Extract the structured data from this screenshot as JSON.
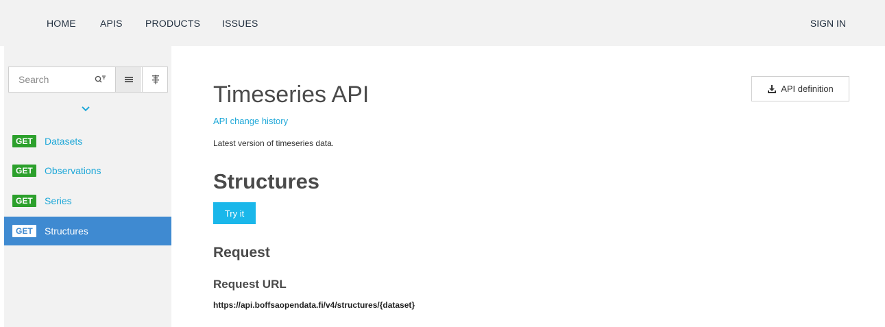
{
  "nav": {
    "items": [
      "HOME",
      "APIS",
      "PRODUCTS",
      "ISSUES"
    ],
    "signin": "SIGN IN"
  },
  "sidebar": {
    "search_placeholder": "Search",
    "operations": [
      {
        "method": "GET",
        "name": "Datasets",
        "active": false
      },
      {
        "method": "GET",
        "name": "Observations",
        "active": false
      },
      {
        "method": "GET",
        "name": "Series",
        "active": false
      },
      {
        "method": "GET",
        "name": "Structures",
        "active": true
      }
    ]
  },
  "main": {
    "api_title": "Timeseries API",
    "api_definition_label": "API definition",
    "change_history_label": "API change history",
    "description": "Latest version of timeseries data.",
    "operation_title": "Structures",
    "try_it_label": "Try it",
    "request_heading": "Request",
    "request_url_heading": "Request URL",
    "request_url": "https://api.boffsaopendata.fi/v4/structures/{dataset}"
  },
  "colors": {
    "accent": "#1fa8d8",
    "get_badge": "#2ca02c",
    "active_item": "#3f8ad1",
    "try_button": "#1ab7ea"
  },
  "icons": [
    "filter-search-icon",
    "list-view-icon",
    "tag-view-icon",
    "chevron-down-icon",
    "download-icon"
  ]
}
